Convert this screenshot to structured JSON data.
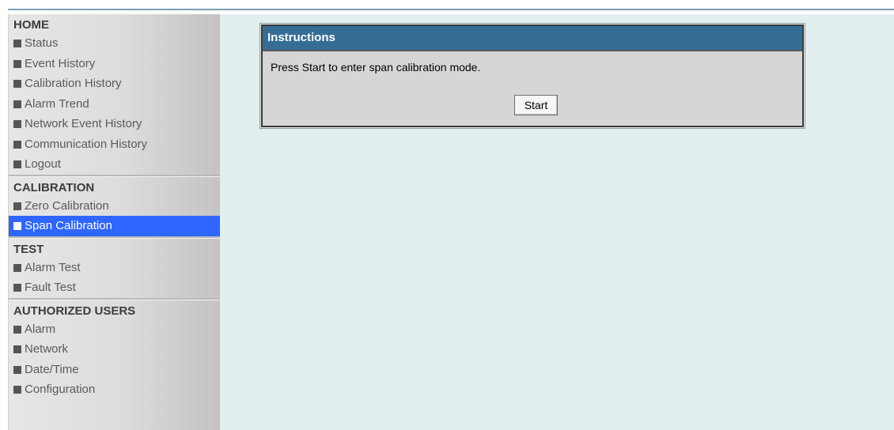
{
  "sidebar": {
    "sections": [
      {
        "title": "HOME",
        "items": [
          {
            "label": "Status"
          },
          {
            "label": "Event History"
          },
          {
            "label": "Calibration History"
          },
          {
            "label": "Alarm Trend"
          },
          {
            "label": "Network Event History"
          },
          {
            "label": "Communication History"
          },
          {
            "label": "Logout"
          }
        ]
      },
      {
        "title": "CALIBRATION",
        "items": [
          {
            "label": "Zero Calibration"
          },
          {
            "label": "Span Calibration",
            "active": true
          }
        ]
      },
      {
        "title": "TEST",
        "items": [
          {
            "label": "Alarm Test"
          },
          {
            "label": "Fault Test"
          }
        ]
      },
      {
        "title": "AUTHORIZED USERS",
        "items": [
          {
            "label": "Alarm"
          },
          {
            "label": "Network"
          },
          {
            "label": "Date/Time"
          },
          {
            "label": "Configuration"
          }
        ]
      }
    ],
    "bullet_icon": "square-bullet-icon"
  },
  "panel": {
    "title": "Instructions",
    "message": "Press Start to enter span calibration mode.",
    "start_label": "Start"
  },
  "colors": {
    "header_blue": "#356d95",
    "active_item": "#2f66ff",
    "content_bg": "#e3eeee",
    "panel_bg": "#d6d6d6"
  }
}
